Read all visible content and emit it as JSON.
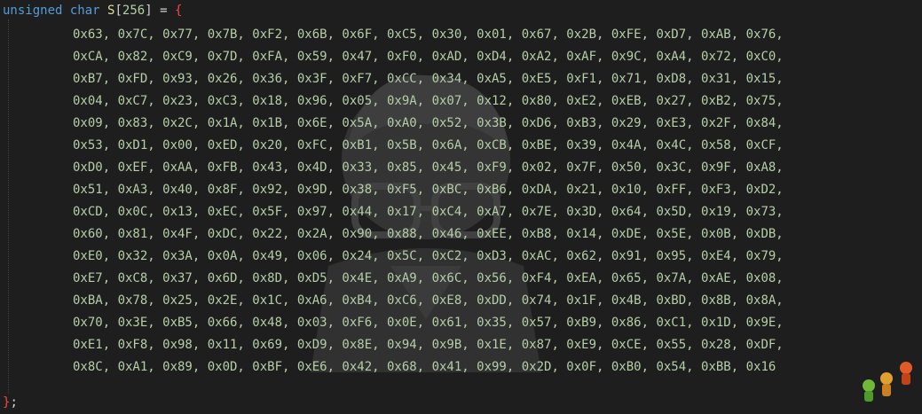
{
  "editor": {
    "declaration": {
      "keyword_unsigned": "unsigned",
      "keyword_char": "char",
      "name": "S",
      "open_bracket": "[",
      "size": "256",
      "close_bracket": "]",
      "assign": " = ",
      "open_brace": "{"
    },
    "rows": [
      "0x63, 0x7C, 0x77, 0x7B, 0xF2, 0x6B, 0x6F, 0xC5, 0x30, 0x01, 0x67, 0x2B, 0xFE, 0xD7, 0xAB, 0x76,",
      "0xCA, 0x82, 0xC9, 0x7D, 0xFA, 0x59, 0x47, 0xF0, 0xAD, 0xD4, 0xA2, 0xAF, 0x9C, 0xA4, 0x72, 0xC0,",
      "0xB7, 0xFD, 0x93, 0x26, 0x36, 0x3F, 0xF7, 0xCC, 0x34, 0xA5, 0xE5, 0xF1, 0x71, 0xD8, 0x31, 0x15,",
      "0x04, 0xC7, 0x23, 0xC3, 0x18, 0x96, 0x05, 0x9A, 0x07, 0x12, 0x80, 0xE2, 0xEB, 0x27, 0xB2, 0x75,",
      "0x09, 0x83, 0x2C, 0x1A, 0x1B, 0x6E, 0x5A, 0xA0, 0x52, 0x3B, 0xD6, 0xB3, 0x29, 0xE3, 0x2F, 0x84,",
      "0x53, 0xD1, 0x00, 0xED, 0x20, 0xFC, 0xB1, 0x5B, 0x6A, 0xCB, 0xBE, 0x39, 0x4A, 0x4C, 0x58, 0xCF,",
      "0xD0, 0xEF, 0xAA, 0xFB, 0x43, 0x4D, 0x33, 0x85, 0x45, 0xF9, 0x02, 0x7F, 0x50, 0x3C, 0x9F, 0xA8,",
      "0x51, 0xA3, 0x40, 0x8F, 0x92, 0x9D, 0x38, 0xF5, 0xBC, 0xB6, 0xDA, 0x21, 0x10, 0xFF, 0xF3, 0xD2,",
      "0xCD, 0x0C, 0x13, 0xEC, 0x5F, 0x97, 0x44, 0x17, 0xC4, 0xA7, 0x7E, 0x3D, 0x64, 0x5D, 0x19, 0x73,",
      "0x60, 0x81, 0x4F, 0xDC, 0x22, 0x2A, 0x90, 0x88, 0x46, 0xEE, 0xB8, 0x14, 0xDE, 0x5E, 0x0B, 0xDB,",
      "0xE0, 0x32, 0x3A, 0x0A, 0x49, 0x06, 0x24, 0x5C, 0xC2, 0xD3, 0xAC, 0x62, 0x91, 0x95, 0xE4, 0x79,",
      "0xE7, 0xC8, 0x37, 0x6D, 0x8D, 0xD5, 0x4E, 0xA9, 0x6C, 0x56, 0xF4, 0xEA, 0x65, 0x7A, 0xAE, 0x08,",
      "0xBA, 0x78, 0x25, 0x2E, 0x1C, 0xA6, 0xB4, 0xC6, 0xE8, 0xDD, 0x74, 0x1F, 0x4B, 0xBD, 0x8B, 0x8A,",
      "0x70, 0x3E, 0xB5, 0x66, 0x48, 0x03, 0xF6, 0x0E, 0x61, 0x35, 0x57, 0xB9, 0x86, 0xC1, 0x1D, 0x9E,",
      "0xE1, 0xF8, 0x98, 0x11, 0x69, 0xD9, 0x8E, 0x94, 0x9B, 0x1E, 0x87, 0xE9, 0xCE, 0x55, 0x28, 0xDF,",
      "0x8C, 0xA1, 0x89, 0x0D, 0xBF, 0xE6, 0x42, 0x68, 0x41, 0x99, 0x2D, 0x0F, 0xB0, 0x54, 0xBB, 0x16"
    ],
    "closing": {
      "brace": "}",
      "semicolon": ";"
    }
  },
  "colors": {
    "background": "#1e1e1e",
    "keyword": "#569cd6",
    "identifier": "#dcdcaa",
    "number": "#b5cea8",
    "brace": "#f44747",
    "punctuation": "#d4d4d4"
  },
  "decorations": {
    "watermark_icon": "anime-character-watermark",
    "corner_icon": "cartoon-figures-sticker"
  }
}
